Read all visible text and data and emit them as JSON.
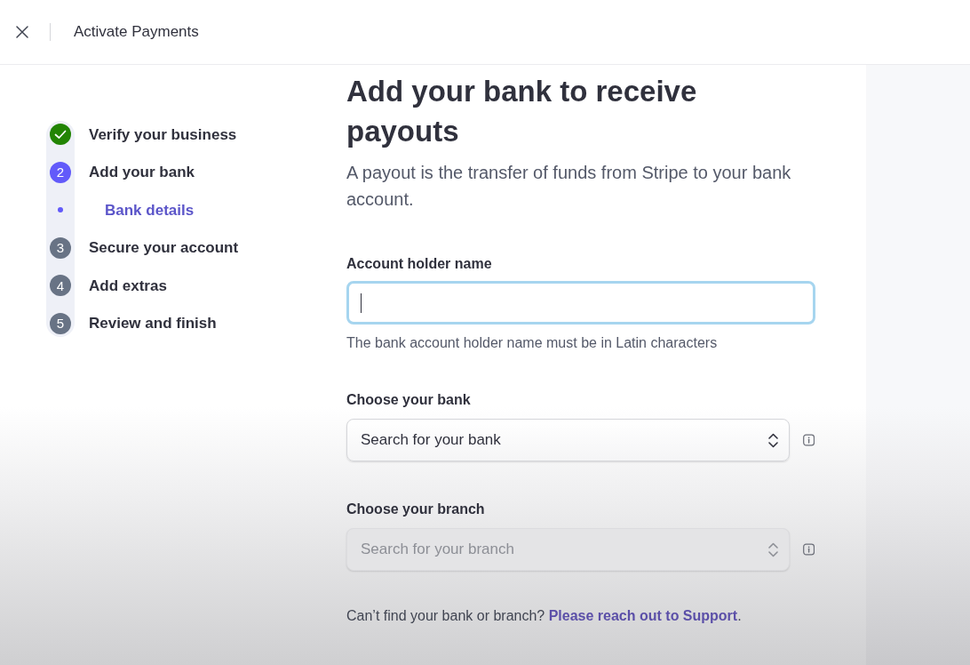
{
  "header": {
    "title": "Activate Payments"
  },
  "steps": [
    {
      "label": "Verify your business",
      "completed": true,
      "selected": false
    },
    {
      "label": "Add your bank",
      "number": "2",
      "completed": false,
      "selected": true,
      "children": [
        {
          "label": "Bank details",
          "selected": true
        }
      ]
    },
    {
      "label": "Secure your account",
      "number": "3",
      "completed": false,
      "selected": false
    },
    {
      "label": "Add extras",
      "number": "4",
      "completed": false,
      "selected": false
    },
    {
      "label": "Review and finish",
      "number": "5",
      "completed": false,
      "selected": false
    }
  ],
  "page": {
    "title": "Add your bank to receive payouts",
    "subtitle": "A payout is the transfer of funds from Stripe to your bank account."
  },
  "fields": [
    {
      "kind": "text",
      "label": "Account holder name",
      "focused": true,
      "hint": "The bank account holder name must be in Latin characters"
    },
    {
      "kind": "select",
      "label": "Choose your bank",
      "placeholder": "Search for your bank",
      "disabled": false
    },
    {
      "kind": "select",
      "label": "Choose your branch",
      "placeholder": "Search for your branch",
      "disabled": true
    }
  ],
  "help": {
    "text": "Can’t find your bank or branch?",
    "link": "Please reach out to Support",
    "end": "."
  }
}
